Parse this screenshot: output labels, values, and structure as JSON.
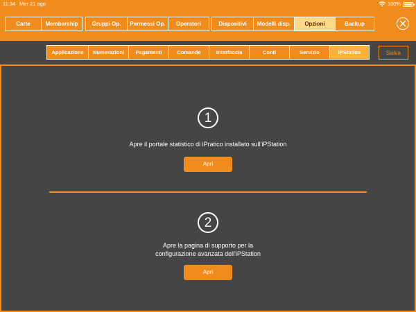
{
  "status_bar": {
    "time": "11:34",
    "date": "Mer 21 ago",
    "battery": "100%"
  },
  "main_tabs": [
    [
      "Carte",
      "Membership"
    ],
    [
      "Gruppi Op.",
      "Permessi Op.",
      "Operatori"
    ],
    [
      "Dispositivi",
      "Modelli disp.",
      "Opzioni",
      "Backup"
    ]
  ],
  "active_main_tab": "Opzioni",
  "sub_tabs": [
    "Applicazione",
    "Numerazioni",
    "Pagamenti",
    "Comande",
    "Interfaccia",
    "Conti",
    "Servizio",
    "iPStation"
  ],
  "active_sub_tab": "iPStation",
  "save_label": "Salva",
  "steps": [
    {
      "number": "1",
      "text_lines": [
        "Apre il portale statistico di iPratico installato sull'iPStation"
      ],
      "button_label": "Apri"
    },
    {
      "number": "2",
      "text_lines": [
        "Apre la pagina di supporto per la",
        "configurazione avanzata dell'iPStation"
      ],
      "button_label": "Apri"
    }
  ],
  "colors": {
    "accent": "#f08c1c",
    "background": "#454545",
    "active_main_tab_bg": "#ffd88a",
    "active_sub_tab_bg": "#ffb13a"
  }
}
